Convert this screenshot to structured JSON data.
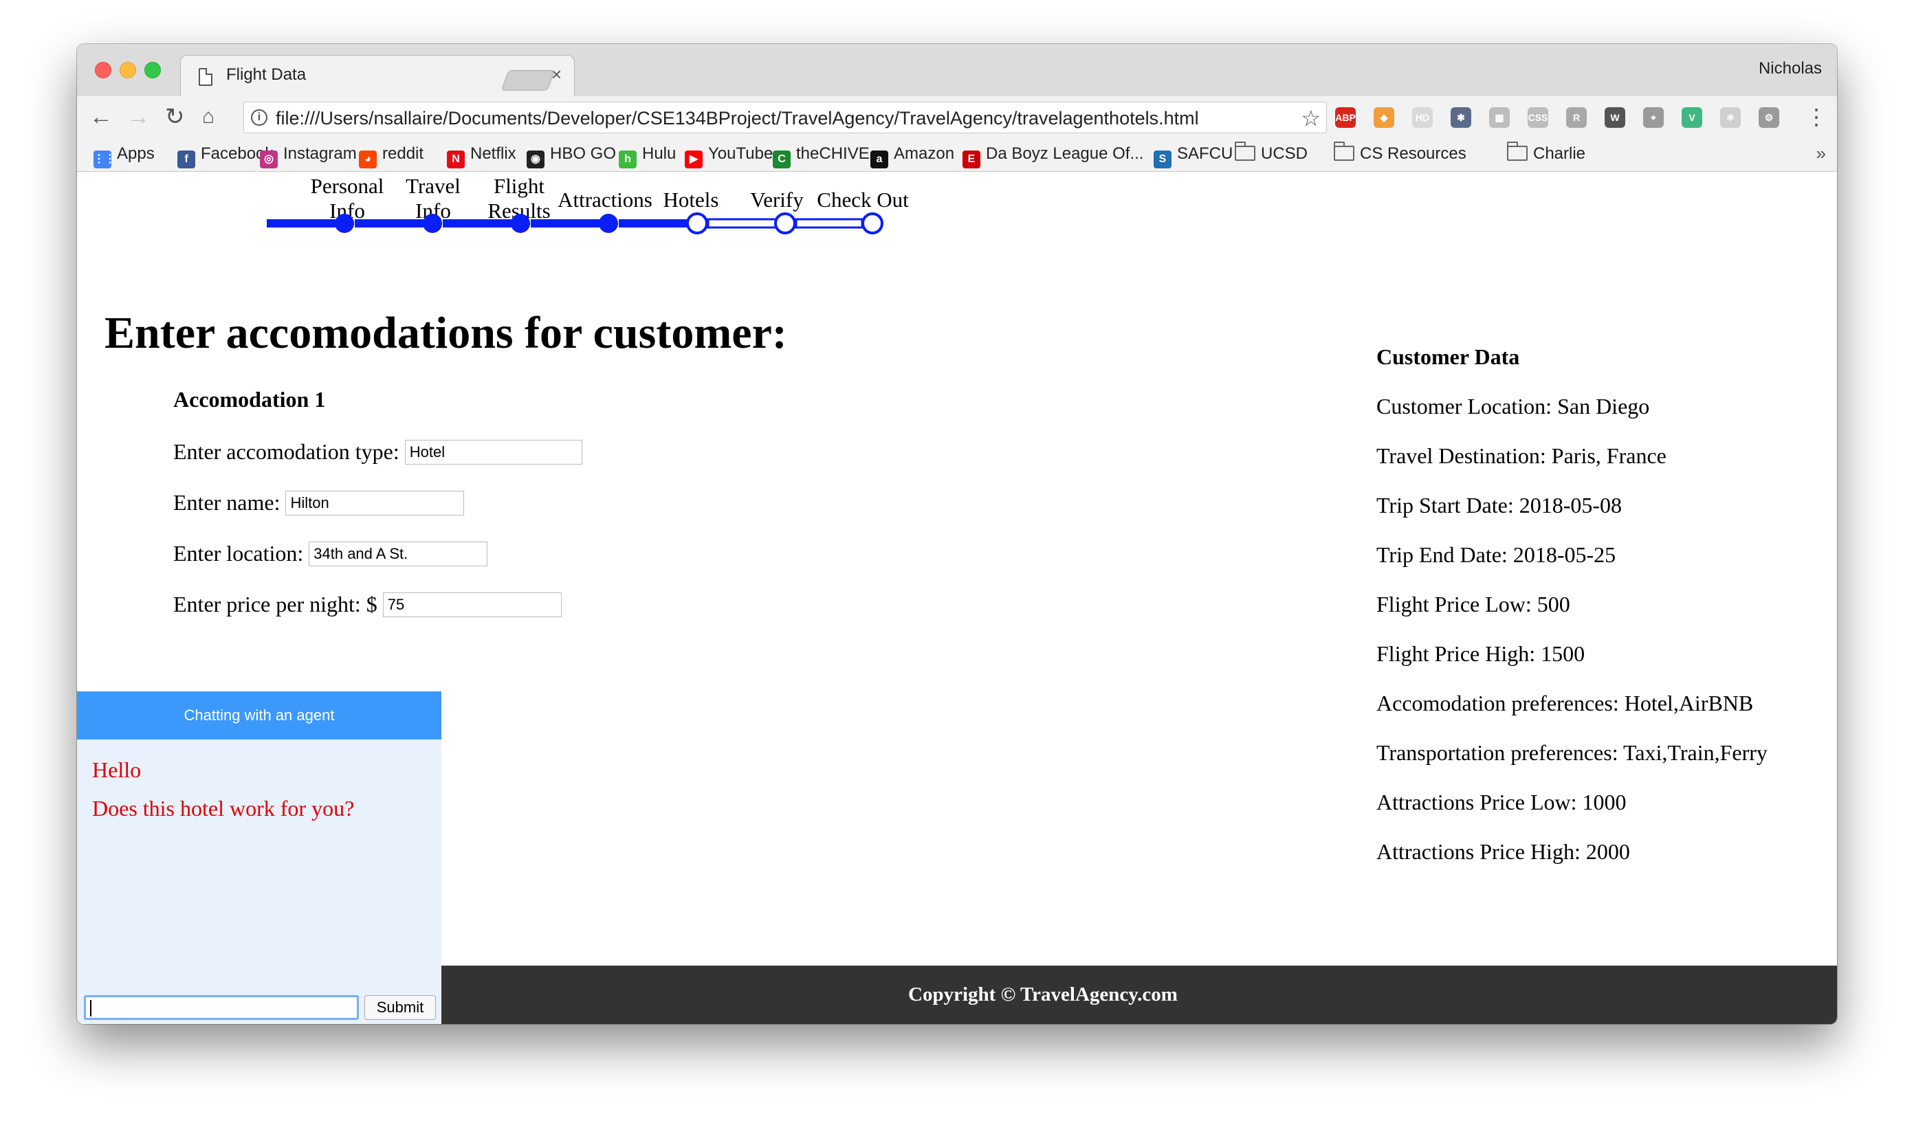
{
  "browser": {
    "tab_title": "Flight Data",
    "tab_close": "×",
    "profile": "Nicholas",
    "url": "file:///Users/nsallaire/Documents/Developer/CSE134BProject/TravelAgency/TravelAgency/travelagenthotels.html",
    "nav": {
      "back": "←",
      "forward": "→",
      "reload": "↻",
      "home": "⌂",
      "star": "☆",
      "menu": "⋮"
    },
    "extensions": [
      {
        "name": "adblock-plus-icon",
        "label": "ABP",
        "color": "#d7261b"
      },
      {
        "name": "extension-orange-icon",
        "label": "◆",
        "color": "#f29d38"
      },
      {
        "name": "hd-extension-icon",
        "label": "HD",
        "color": "#d9d9d9"
      },
      {
        "name": "gear-extension-icon",
        "label": "✱",
        "color": "#5b6a8a"
      },
      {
        "name": "extension-grey-icon-1",
        "label": "▦",
        "color": "#bdbdbd"
      },
      {
        "name": "extension-grey-icon-2",
        "label": "CSS",
        "color": "#bdbdbd"
      },
      {
        "name": "extension-grey-icon-3",
        "label": "R",
        "color": "#a8a8a8"
      },
      {
        "name": "wordpress-icon",
        "label": "W",
        "color": "#555555"
      },
      {
        "name": "extension-pin-icon",
        "label": "⌖",
        "color": "#9a9a9a"
      },
      {
        "name": "vue-devtools-icon",
        "label": "V",
        "color": "#41b883"
      },
      {
        "name": "react-devtools-icon",
        "label": "⚛",
        "color": "#cfcfcf"
      },
      {
        "name": "settings-extension-icon",
        "label": "⚙",
        "color": "#9a9a9a"
      }
    ],
    "bookmarks": [
      {
        "name": "Apps",
        "icon": "apps-grid-icon",
        "color": "#4285f4",
        "glyph": "⋮⋮"
      },
      {
        "name": "Facebook",
        "icon": "facebook-icon",
        "color": "#3b5998",
        "glyph": "f"
      },
      {
        "name": "Instagram",
        "icon": "instagram-icon",
        "color": "#c13584",
        "glyph": "◎"
      },
      {
        "name": "reddit",
        "icon": "reddit-icon",
        "color": "#ff4500",
        "glyph": "◕"
      },
      {
        "name": "Netflix",
        "icon": "netflix-icon",
        "color": "#e50914",
        "glyph": "N"
      },
      {
        "name": "HBO GO",
        "icon": "hbo-icon",
        "color": "#222222",
        "glyph": "◉"
      },
      {
        "name": "Hulu",
        "icon": "hulu-icon",
        "color": "#3dbb3d",
        "glyph": "h"
      },
      {
        "name": "YouTube",
        "icon": "youtube-icon",
        "color": "#ff0000",
        "glyph": "▶"
      },
      {
        "name": "theCHIVE",
        "icon": "thechive-icon",
        "color": "#1a8a2e",
        "glyph": "C"
      },
      {
        "name": "Amazon",
        "icon": "amazon-icon",
        "color": "#111111",
        "glyph": "a"
      },
      {
        "name": "Da Boyz League Of...",
        "icon": "espn-icon",
        "color": "#cc0000",
        "glyph": "E"
      },
      {
        "name": "SAFCU",
        "icon": "safcu-icon",
        "color": "#1f6fb5",
        "glyph": "S"
      },
      {
        "name": "UCSD",
        "icon": "folder-icon",
        "color": "",
        "glyph": ""
      },
      {
        "name": "CS Resources",
        "icon": "folder-icon",
        "color": "",
        "glyph": ""
      },
      {
        "name": "Charlie",
        "icon": "folder-icon",
        "color": "",
        "glyph": ""
      }
    ],
    "bookmarks_more": "»"
  },
  "steps": {
    "items": [
      {
        "label": "Personal\nInfo",
        "status": "done"
      },
      {
        "label": "Travel\nInfo",
        "status": "done"
      },
      {
        "label": "Flight\nResults",
        "status": "done"
      },
      {
        "label": "Attractions",
        "status": "done"
      },
      {
        "label": "Hotels",
        "status": "current"
      },
      {
        "label": "Verify",
        "status": "todo"
      },
      {
        "label": "Check Out",
        "status": "todo"
      }
    ],
    "color": "#0a1ff5"
  },
  "page": {
    "heading": "Enter accomodations for customer:",
    "accommodation_title": "Accomodation 1",
    "fields": {
      "type_label": "Enter accomodation type:",
      "type_value": "Hotel",
      "name_label": "Enter name:",
      "name_value": "Hilton",
      "location_label": "Enter location:",
      "location_value": "34th and A St.",
      "price_label": "Enter price per night: $",
      "price_value": "75"
    }
  },
  "customer": {
    "title": "Customer Data",
    "lines": [
      "Customer Location: San Diego",
      "Travel Destination: Paris, France",
      "Trip Start Date: 2018-05-08",
      "Trip End Date: 2018-05-25",
      "Flight Price Low: 500",
      "Flight Price High: 1500",
      "Accomodation preferences: Hotel,AirBNB",
      "Transportation preferences: Taxi,Train,Ferry",
      "Attractions Price Low: 1000",
      "Attractions Price High: 2000"
    ]
  },
  "chat": {
    "header": "Chatting with an agent",
    "messages": [
      "Hello",
      "Does this hotel work for you?"
    ],
    "input_value": "",
    "submit_label": "Submit",
    "header_color": "#3b99fc",
    "message_color": "#e00000"
  },
  "footer": {
    "text": "Copyright © TravelAgency.com"
  }
}
